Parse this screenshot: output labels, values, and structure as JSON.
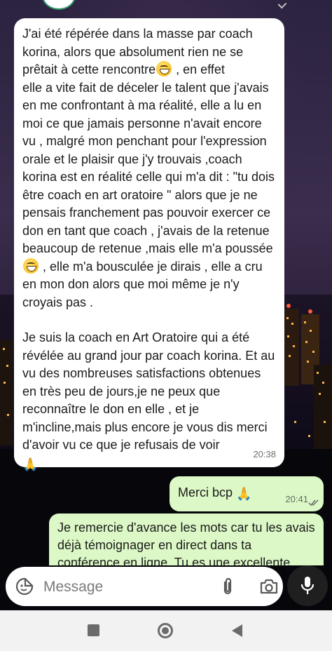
{
  "conversation": {
    "incoming_message": {
      "paragraph_1_before_emoji_1": "J'ai été répérée dans la masse par coach korina, alors que absolument rien ne se prêtait à cette rencontre",
      "paragraph_1_between_emojis": " , en effet\nelle a vite fait de déceler le talent que j'avais en me confrontant à ma réalité, elle a lu en moi ce que jamais personne n'avait encore vu , malgré mon penchant pour l'expression orale et le plaisir que j'y trouvais ,coach korina est en réalité celle qui m'a dit : \"tu dois être coach en art oratoire \" alors que je ne pensais franchement pas pouvoir exercer ce don en tant que coach , j'avais de la retenue beaucoup de retenue ,mais elle m'a poussée",
      "paragraph_1_after_emoji_2": " , elle m'a bousculée je dirais , elle a cru en mon don alors que moi même je n'y croyais pas .",
      "paragraph_2": "Je suis la coach en Art Oratoire qui a été révélée au grand jour par coach korina. Et au vu des nombreuses satisfactions obtenues  en très peu de jours,je ne peux que reconnaître le don  en elle , et je m'incline,mais plus encore je vous dis merci d'avoir vu ce que je refusais de voir",
      "emoji_laugh": "grinning-sweat-emoji",
      "emoji_pray": "🙏",
      "time": "20:38"
    },
    "outgoing_message_1": {
      "text": "Merci bcp",
      "emoji": "🙏",
      "time": "20:41",
      "status": "read-double-check"
    },
    "outgoing_message_2": {
      "text": "Je remercie d'avance les mots car tu les avais déjà témoignager en direct dans ta conférence en ligne. Tu es une excellente"
    }
  },
  "composer": {
    "placeholder": "Message",
    "icons": [
      "sticker-icon",
      "attach-icon",
      "camera-icon",
      "mic-icon"
    ]
  },
  "navbar": {
    "icons": [
      "recents-icon",
      "home-icon",
      "back-icon"
    ]
  },
  "colors": {
    "incoming_bubble": "#ffffff",
    "outgoing_bubble": "#dcf8c6",
    "mic_button": "#1f1f1f",
    "navbar": "#f2f2f2"
  }
}
